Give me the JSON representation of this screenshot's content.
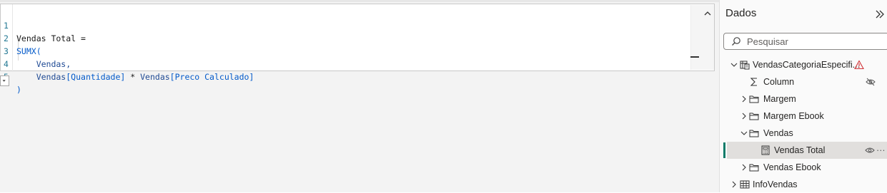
{
  "editor": {
    "lines": [
      {
        "number": "1",
        "tokens": [
          {
            "t": "Vendas Total =",
            "c": "tx"
          }
        ]
      },
      {
        "number": "2",
        "tokens": [
          {
            "t": "SUMX(",
            "c": "kw"
          }
        ]
      },
      {
        "number": "3",
        "tokens": [
          {
            "t": "    Vendas,",
            "c": "col"
          }
        ]
      },
      {
        "number": "4",
        "tokens": [
          {
            "t": "    Vendas",
            "c": "col"
          },
          {
            "t": "[Quantidade]",
            "c": "kw"
          },
          {
            "t": " * ",
            "c": "tx"
          },
          {
            "t": "Vendas",
            "c": "col"
          },
          {
            "t": "[Preco Calculado]",
            "c": "kw"
          }
        ]
      },
      {
        "number": "5",
        "tokens": [
          {
            "t": ")",
            "c": "kw"
          }
        ]
      }
    ]
  },
  "data_pane": {
    "title": "Dados",
    "search_placeholder": "Pesquisar",
    "tree": [
      {
        "label": "VendasCategoriaEspecifi...",
        "icon": "calc-table-icon",
        "expander": "chevron-down-icon",
        "status_icon": "warning-icon",
        "level": 0
      },
      {
        "label": "Column",
        "icon": "sigma-icon",
        "expander": "",
        "status_icon": "hidden-eye-icon",
        "level": 1
      },
      {
        "label": "Margem",
        "icon": "folder-icon",
        "expander": "chevron-right-icon",
        "level": 1
      },
      {
        "label": "Margem Ebook",
        "icon": "folder-icon",
        "expander": "chevron-right-icon",
        "level": 1
      },
      {
        "label": "Vendas",
        "icon": "folder-icon",
        "expander": "chevron-down-icon",
        "level": 1
      },
      {
        "label": "Vendas Total",
        "icon": "calculator-icon",
        "expander": "",
        "status_icon": "eye-icon",
        "more": "···",
        "level": 2,
        "selected": true
      },
      {
        "label": "Vendas Ebook",
        "icon": "folder-icon",
        "expander": "chevron-right-icon",
        "level": 1
      },
      {
        "label": "InfoVendas",
        "icon": "table-icon",
        "expander": "chevron-right-icon",
        "level": 0
      }
    ]
  },
  "colors": {
    "keyword": "#035aca",
    "column": "#1f4a94",
    "selected_accent": "#107c6a",
    "warning": "#d13438"
  }
}
